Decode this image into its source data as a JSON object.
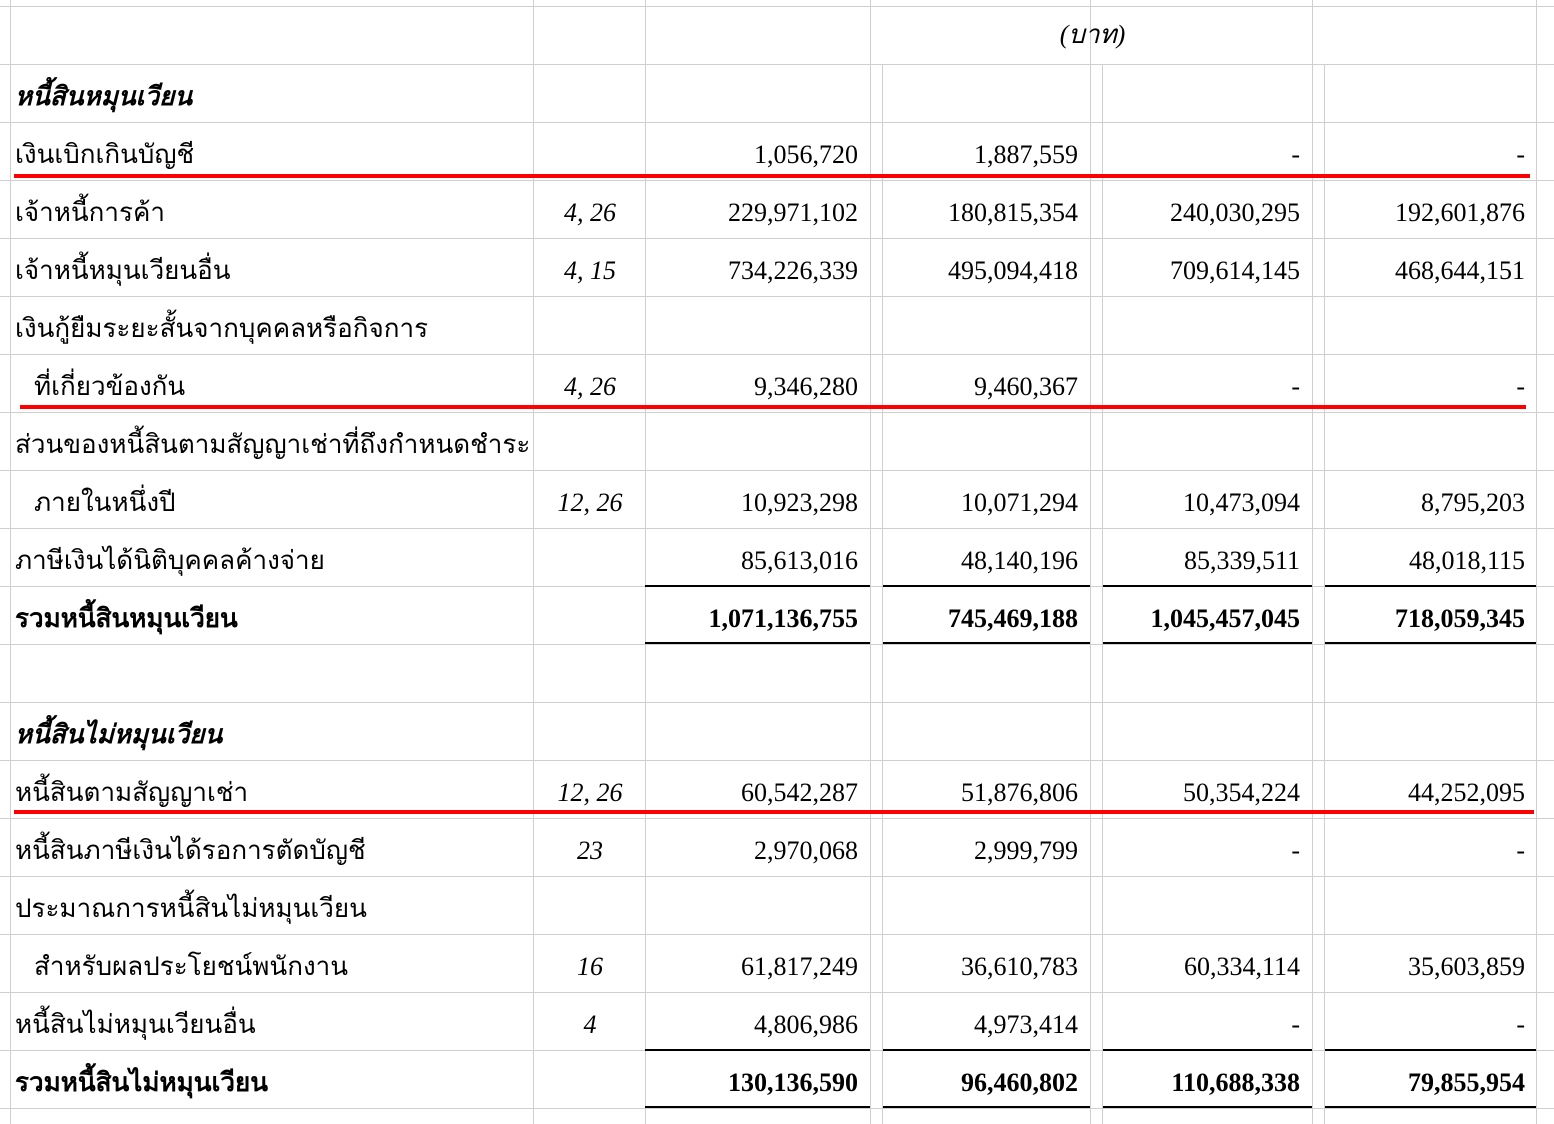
{
  "unit_label": "(บาท)",
  "rows": [
    {
      "label": "หนี้สินหมุนเวียน",
      "note": "",
      "values": [
        "",
        "",
        "",
        ""
      ],
      "style": "heading"
    },
    {
      "label": "เงินเบิกเกินบัญชี",
      "note": "",
      "values": [
        "1,056,720",
        "1,887,559",
        "-",
        "-"
      ]
    },
    {
      "label": "เจ้าหนี้การค้า",
      "note": "4, 26",
      "values": [
        "229,971,102",
        "180,815,354",
        "240,030,295",
        "192,601,876"
      ]
    },
    {
      "label": "เจ้าหนี้หมุนเวียนอื่น",
      "note": "4, 15",
      "values": [
        "734,226,339",
        "495,094,418",
        "709,614,145",
        "468,644,151"
      ]
    },
    {
      "label": "เงินกู้ยืมระยะสั้นจากบุคคลหรือกิจการ",
      "note": "",
      "values": [
        "",
        "",
        "",
        ""
      ]
    },
    {
      "label": "ที่เกี่ยวข้องกัน",
      "note": "4, 26",
      "values": [
        "9,346,280",
        "9,460,367",
        "-",
        "-"
      ],
      "indent": true
    },
    {
      "label": "ส่วนของหนี้สินตามสัญญาเช่าที่ถึงกำหนดชำระ",
      "note": "",
      "values": [
        "",
        "",
        "",
        ""
      ]
    },
    {
      "label": "ภายในหนึ่งปี",
      "note": "12, 26",
      "values": [
        "10,923,298",
        "10,071,294",
        "10,473,094",
        "8,795,203"
      ],
      "indent": true
    },
    {
      "label": "ภาษีเงินได้นิติบุคคลค้างจ่าย",
      "note": "",
      "values": [
        "85,613,016",
        "48,140,196",
        "85,339,511",
        "48,018,115"
      ]
    },
    {
      "label": "รวมหนี้สินหมุนเวียน",
      "note": "",
      "values": [
        "1,071,136,755",
        "745,469,188",
        "1,045,457,045",
        "718,059,345"
      ],
      "style": "bold"
    },
    {
      "label": "",
      "note": "",
      "values": [
        "",
        "",
        "",
        ""
      ]
    },
    {
      "label": "หนี้สินไม่หมุนเวียน",
      "note": "",
      "values": [
        "",
        "",
        "",
        ""
      ],
      "style": "heading"
    },
    {
      "label": "หนี้สินตามสัญญาเช่า",
      "note": "12, 26",
      "values": [
        "60,542,287",
        "51,876,806",
        "50,354,224",
        "44,252,095"
      ]
    },
    {
      "label": "หนี้สินภาษีเงินได้รอการตัดบัญชี",
      "note": "23",
      "values": [
        "2,970,068",
        "2,999,799",
        "-",
        "-"
      ]
    },
    {
      "label": "ประมาณการหนี้สินไม่หมุนเวียน",
      "note": "",
      "values": [
        "",
        "",
        "",
        ""
      ]
    },
    {
      "label": "สำหรับผลประโยชน์พนักงาน",
      "note": "16",
      "values": [
        "61,817,249",
        "36,610,783",
        "60,334,114",
        "35,603,859"
      ],
      "indent": true
    },
    {
      "label": "หนี้สินไม่หมุนเวียนอื่น",
      "note": "4",
      "values": [
        "4,806,986",
        "4,973,414",
        "-",
        "-"
      ]
    },
    {
      "label": "รวมหนี้สินไม่หมุนเวียน",
      "note": "",
      "values": [
        "130,136,590",
        "96,460,802",
        "110,688,338",
        "79,855,954"
      ],
      "style": "bold"
    }
  ]
}
